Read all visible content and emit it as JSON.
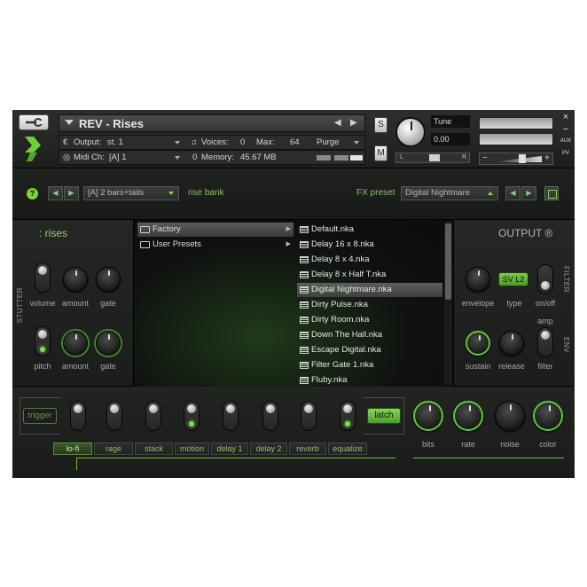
{
  "header": {
    "title": "REV - Rises",
    "output_label": "Output:",
    "output_value": "st. 1",
    "voices_label": "Voices:",
    "voices_value": "0",
    "max_label": "Max:",
    "max_value": "64",
    "purge_label": "Purge",
    "midi_label": "Midi Ch:",
    "midi_value": "[A]  1",
    "memory_label": "Memory:",
    "memory_value": "45.67 MB",
    "memory_count": "0",
    "solo_label": "S",
    "mute_label": "M",
    "tune_label": "Tune",
    "tune_value": "0.00",
    "pan_left": "L",
    "pan_right": "R",
    "vol_minus": "−",
    "vol_plus": "+",
    "close": "×",
    "minimize": "−",
    "aux_label": "AUX",
    "pv_label": "PV"
  },
  "preset_bar": {
    "help": "?",
    "pattern_value": "[A] 2 bars+tails",
    "bank_label": "rise bank",
    "fx_preset_label": "FX preset",
    "fx_preset_value": "Digital Nightmare"
  },
  "left_panel": {
    "title": ": rises",
    "section_label": "STUTTER",
    "knobs_row1": [
      "volume",
      "amount",
      "gate"
    ],
    "knobs_row2": [
      "pitch",
      "amount",
      "gate"
    ]
  },
  "browser": {
    "folders": [
      {
        "label": "Factory",
        "selected": true
      },
      {
        "label": "User Presets",
        "selected": false
      }
    ],
    "files": [
      {
        "label": "Default.nka",
        "selected": false
      },
      {
        "label": "Delay 16 x 8.nka",
        "selected": false
      },
      {
        "label": "Delay 8 x 4.nka",
        "selected": false
      },
      {
        "label": "Delay 8 x Half T.nka",
        "selected": false
      },
      {
        "label": "Digital Nightmare.nka",
        "selected": true
      },
      {
        "label": "Dirty Pulse.nka",
        "selected": false
      },
      {
        "label": "Dirty Room.nka",
        "selected": false
      },
      {
        "label": "Down The Hall.nka",
        "selected": false
      },
      {
        "label": "Escape Digital.nka",
        "selected": false
      },
      {
        "label": "Filter Gate 1.nka",
        "selected": false
      },
      {
        "label": "Fluby.nka",
        "selected": false
      }
    ]
  },
  "right_panel": {
    "title": "OUTPUT ®",
    "filter_label": "FILTER",
    "env_label": "ENV",
    "type_value": "SV L2",
    "labels_row1": [
      "envelope",
      "type",
      "on/off"
    ],
    "labels_row2": [
      "sustain",
      "release",
      "filter"
    ],
    "amp_label": "amp"
  },
  "bottom": {
    "trigger_label": "trigger",
    "latch_label": "latch",
    "tabs": [
      "lo-fi",
      "rage",
      "stack",
      "motion",
      "delay 1",
      "delay 2",
      "reverb",
      "equalize"
    ],
    "active_tab": "lo-fi",
    "knob_labels": [
      "bits",
      "rate",
      "noise",
      "color"
    ]
  }
}
